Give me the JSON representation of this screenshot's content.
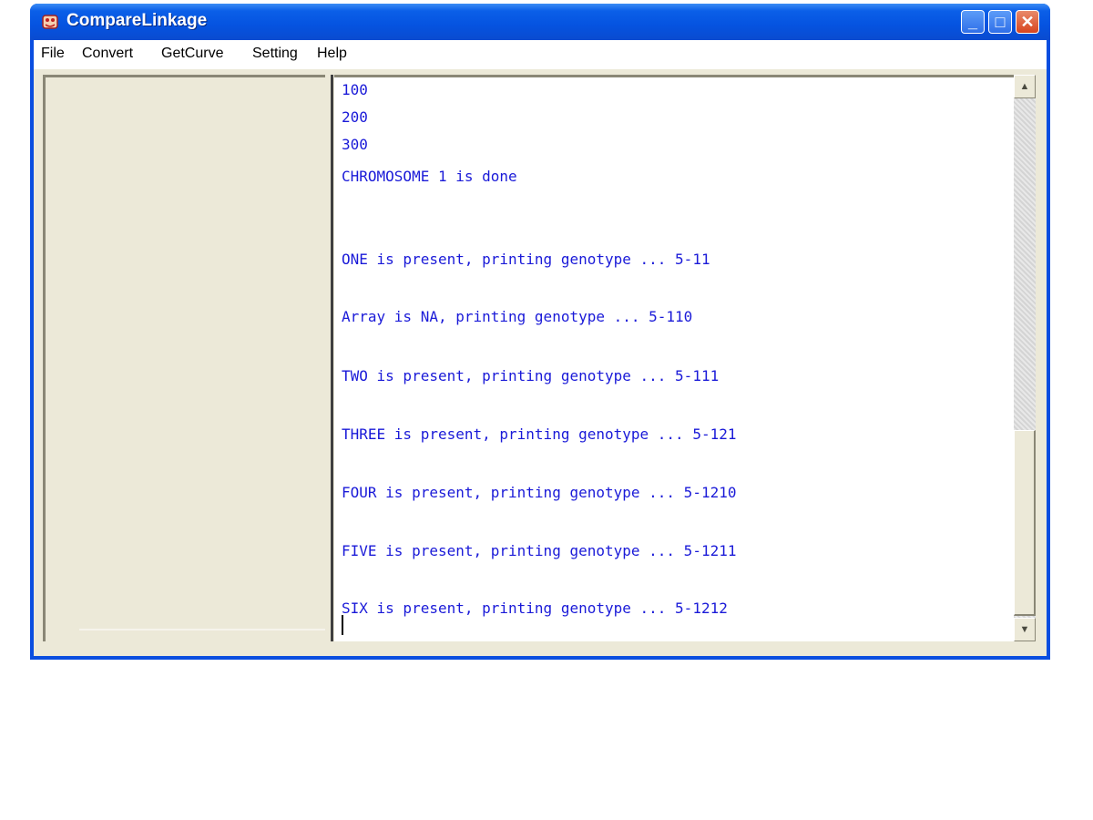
{
  "window": {
    "title": "CompareLinkage",
    "app_icon": "compare-linkage-app-icon",
    "controls": {
      "minimize": "_",
      "maximize": "□",
      "close": "✕"
    }
  },
  "menu": {
    "items": [
      {
        "label": "File"
      },
      {
        "label": "Convert"
      },
      {
        "label": "GetCurve"
      },
      {
        "label": "Setting"
      },
      {
        "label": "Help"
      }
    ]
  },
  "output": {
    "lines": [
      "100",
      "200",
      "300",
      "CHROMOSOME 1 is done",
      "ONE is present, printing genotype ... 5-11",
      "Array is NA, printing genotype ... 5-110",
      "TWO is present, printing genotype ... 5-111",
      "THREE is present, printing genotype ... 5-121",
      "FOUR is present, printing genotype ... 5-1210",
      "FIVE is present, printing genotype ... 5-1211",
      "SIX is present, printing genotype ... 5-1212"
    ],
    "text_color": "#1a1ad8"
  },
  "scrollbar": {
    "up_arrow": "▲",
    "down_arrow": "▼",
    "scroll_position_fraction": 1.0
  },
  "colors": {
    "titlebar": "#0553e0",
    "face": "#ece9d8",
    "text_blue": "#1a1ad8"
  }
}
